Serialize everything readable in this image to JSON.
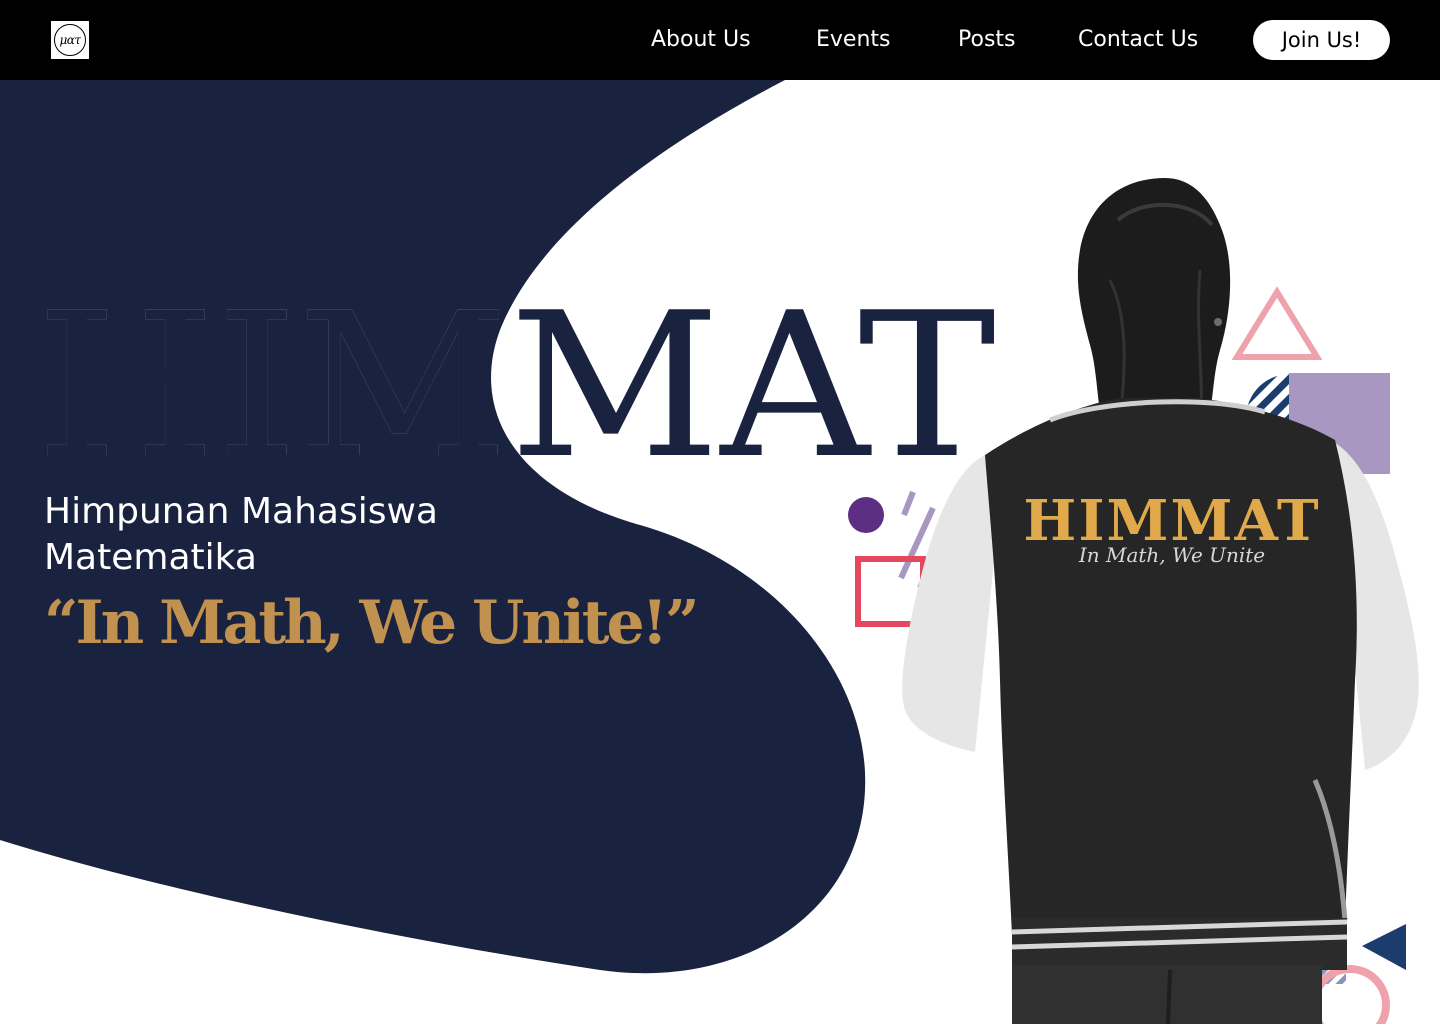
{
  "nav": {
    "logo_text": "ματ",
    "links": [
      {
        "label": "About Us"
      },
      {
        "label": "Events"
      },
      {
        "label": "Posts"
      },
      {
        "label": "Contact Us"
      }
    ],
    "join_label": "Join Us!"
  },
  "hero": {
    "title": "HIMMAT",
    "subtitle_line1": "Himpunan Mahasiswa",
    "subtitle_line2": "Matematika",
    "tagline": "“In Math, We Unite!”"
  },
  "jacket": {
    "print_title": "HIMMAT",
    "print_script": "In Math, We Unite"
  },
  "colors": {
    "navy": "#19223f",
    "gold": "#c1914f",
    "nav_bg": "#000000",
    "pink": "#eda2ac",
    "lavender": "#a797c1",
    "purple": "#5c2f83",
    "red": "#e4485e",
    "blue": "#1b3c6d"
  }
}
